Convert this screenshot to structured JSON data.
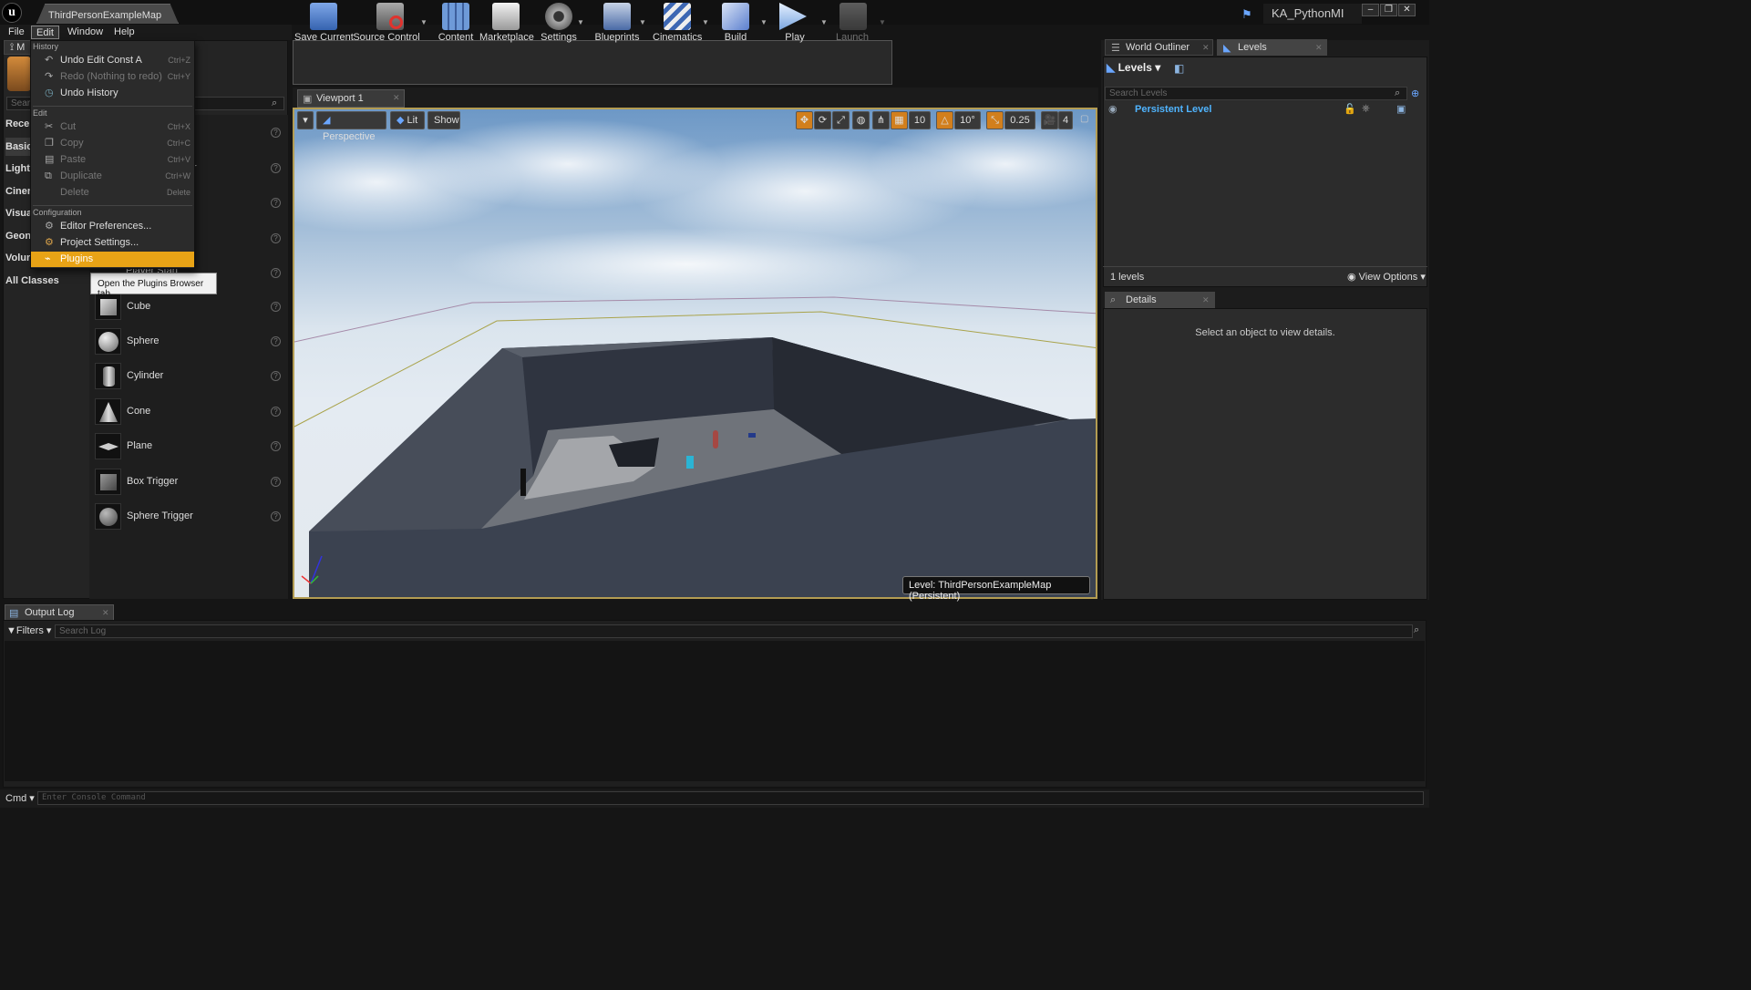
{
  "window": {
    "map_tab": "ThirdPersonExampleMap",
    "project": "KA_PythonMI",
    "buttons": [
      "minimize-icon",
      "restore-icon",
      "close-icon"
    ]
  },
  "menubar": {
    "items": [
      "File",
      "Edit",
      "Window",
      "Help"
    ],
    "active": "Edit"
  },
  "edit_menu": {
    "section_history": "History",
    "history": [
      {
        "label": "Undo Edit Const A",
        "shortcut": "Ctrl+Z",
        "icon": "undo-icon",
        "disabled": false
      },
      {
        "label": "Redo (Nothing to redo)",
        "shortcut": "Ctrl+Y",
        "icon": "redo-icon",
        "disabled": true
      },
      {
        "label": "Undo History",
        "shortcut": "",
        "icon": "history-icon",
        "disabled": false
      }
    ],
    "section_edit": "Edit",
    "edit": [
      {
        "label": "Cut",
        "shortcut": "Ctrl+X",
        "icon": "cut-icon",
        "disabled": true
      },
      {
        "label": "Copy",
        "shortcut": "Ctrl+C",
        "icon": "copy-icon",
        "disabled": true
      },
      {
        "label": "Paste",
        "shortcut": "Ctrl+V",
        "icon": "paste-icon",
        "disabled": true
      },
      {
        "label": "Duplicate",
        "shortcut": "Ctrl+W",
        "icon": "duplicate-icon",
        "disabled": true
      },
      {
        "label": "Delete",
        "shortcut": "Delete",
        "icon": "delete-icon",
        "disabled": true
      }
    ],
    "section_config": "Configuration",
    "config": [
      {
        "label": "Editor Preferences...",
        "icon": "preferences-icon"
      },
      {
        "label": "Project Settings...",
        "icon": "settings-icon"
      },
      {
        "label": "Plugins",
        "icon": "plugin-icon",
        "highlighted": true
      }
    ],
    "tooltip": "Open the Plugins Browser tab."
  },
  "modes": {
    "tab_label": "M",
    "search_placeholder": "Sear",
    "categories": [
      "Rece",
      "Basic",
      "Light",
      "Ciner",
      "Visua",
      "Geon",
      "Volur",
      "All Classes"
    ],
    "selected_category": "Basic",
    "partial_items": [
      "r",
      "Player Start"
    ],
    "items": [
      "Cube",
      "Sphere",
      "Cylinder",
      "Cone",
      "Plane",
      "Box Trigger",
      "Sphere Trigger"
    ]
  },
  "toolbar": {
    "buttons": [
      {
        "label": "Save Current",
        "icon": "save-icon"
      },
      {
        "label": "Source Control",
        "icon": "source-control-icon"
      },
      {
        "label": "Content",
        "icon": "content-icon"
      },
      {
        "label": "Marketplace",
        "icon": "marketplace-icon"
      },
      {
        "label": "Settings",
        "icon": "settings-icon"
      },
      {
        "label": "Blueprints",
        "icon": "blueprints-icon"
      },
      {
        "label": "Cinematics",
        "icon": "cinematics-icon"
      },
      {
        "label": "Build",
        "icon": "build-icon"
      },
      {
        "label": "Play",
        "icon": "play-icon"
      },
      {
        "label": "Launch",
        "icon": "launch-icon"
      }
    ]
  },
  "viewport": {
    "tab": "Viewport 1",
    "perspective": "Perspective",
    "lit": "Lit",
    "show": "Show",
    "grid_snap": "10",
    "rotation_snap": "10°",
    "scale_snap": "0.25",
    "camera_speed": "4",
    "level_label": "Level:  ThirdPersonExampleMap (Persistent)"
  },
  "levels_panel": {
    "tabs": [
      "World Outliner",
      "Levels"
    ],
    "active_tab": "Levels",
    "header": "Levels",
    "search_placeholder": "Search Levels",
    "rows": [
      "Persistent Level"
    ],
    "count": "1 levels",
    "view_options": "View Options"
  },
  "details_panel": {
    "tab": "Details",
    "empty": "Select an object to view details."
  },
  "output_log": {
    "tab": "Output Log",
    "filters": "Filters",
    "search_placeholder": "Search Log"
  },
  "console": {
    "cmd_label": "Cmd",
    "placeholder": "Enter Console Command"
  },
  "colors": {
    "accent": "#e8a316",
    "level_link": "#4fb4ff",
    "viewport_border": "#b39c52"
  }
}
